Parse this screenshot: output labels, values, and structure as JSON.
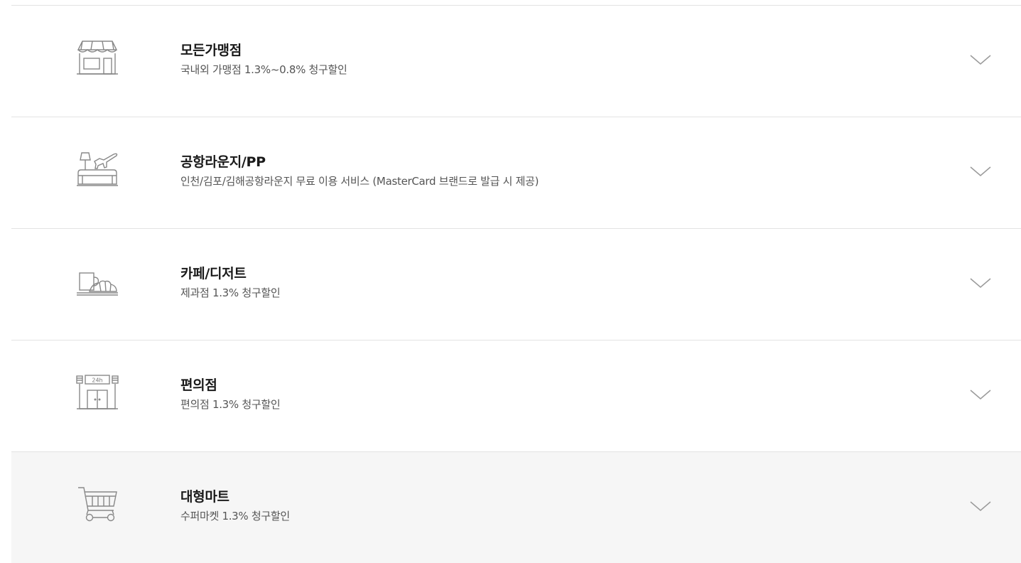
{
  "benefits": [
    {
      "icon": "store-icon",
      "title": "모든가맹점",
      "desc": "국내외 가맹점 1.3%~0.8% 청구할인"
    },
    {
      "icon": "airport-lounge-icon",
      "title": "공항라운지/PP",
      "desc": "인천/김포/김해공항라운지 무료 이용 서비스 (MasterCard 브랜드로 발급 시 제공)"
    },
    {
      "icon": "cafe-dessert-icon",
      "title": "카페/디저트",
      "desc": "제과점 1.3% 청구할인"
    },
    {
      "icon": "convenience-store-icon",
      "title": "편의점",
      "desc": "편의점 1.3% 청구할인",
      "badge": "24h"
    },
    {
      "icon": "shopping-cart-icon",
      "title": "대형마트",
      "desc": "수퍼마켓 1.3% 청구할인"
    }
  ],
  "colors": {
    "divider": "#e3e3e3",
    "hover_background": "#f6f6f6",
    "title": "#1a1a1a",
    "desc": "#555555",
    "icon_stroke": "#888888",
    "chevron": "#9a9a9a"
  }
}
